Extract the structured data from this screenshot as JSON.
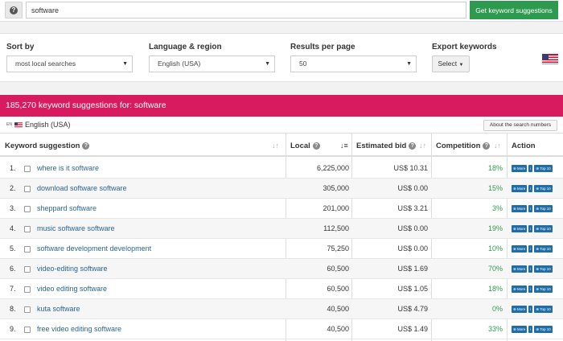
{
  "search": {
    "help_symbol": "?",
    "value": "software",
    "submit_label": "Get keyword suggestions"
  },
  "filters": {
    "sort_by": {
      "label": "Sort by",
      "selected": "most local searches"
    },
    "language": {
      "label": "Language & region",
      "selected": "English (USA)"
    },
    "results": {
      "label": "Results per page",
      "selected": "50"
    },
    "export": {
      "label": "Export keywords",
      "selected": "Select"
    }
  },
  "results": {
    "banner": "185,270 keyword suggestions for: software",
    "language_tag": "English (USA)",
    "language_code": "EN",
    "about_button": "About the search numbers"
  },
  "table": {
    "headers": {
      "keyword": "Keyword suggestion",
      "local": "Local",
      "bid": "Estimated bid",
      "competition": "Competition",
      "action": "Action"
    },
    "action_labels": {
      "more": "More",
      "info": "i",
      "top": "Top 10"
    },
    "rows": [
      {
        "num": "1.",
        "keyword": "where is it software",
        "local": "6,225,000",
        "bid": "US$ 10.31",
        "competition": "18%"
      },
      {
        "num": "2.",
        "keyword": "download software software",
        "local": "305,000",
        "bid": "US$ 0.00",
        "competition": "15%"
      },
      {
        "num": "3.",
        "keyword": "sheppard software",
        "local": "201,000",
        "bid": "US$ 3.21",
        "competition": "3%"
      },
      {
        "num": "4.",
        "keyword": "music software software",
        "local": "112,500",
        "bid": "US$ 0.00",
        "competition": "19%"
      },
      {
        "num": "5.",
        "keyword": "software development development",
        "local": "75,250",
        "bid": "US$ 0.00",
        "competition": "10%"
      },
      {
        "num": "6.",
        "keyword": "video-editing software",
        "local": "60,500",
        "bid": "US$ 1.69",
        "competition": "70%"
      },
      {
        "num": "7.",
        "keyword": "video editing software",
        "local": "60,500",
        "bid": "US$ 1.05",
        "competition": "18%"
      },
      {
        "num": "8.",
        "keyword": "kuta software",
        "local": "40,500",
        "bid": "US$ 4.79",
        "competition": "0%"
      },
      {
        "num": "9.",
        "keyword": "free video editing software",
        "local": "40,500",
        "bid": "US$ 1.49",
        "competition": "33%"
      }
    ]
  },
  "colors": {
    "banner": "#d81b5e",
    "submit": "#2d9a4f",
    "link": "#2a6496",
    "competition": "#2d9a4f",
    "action_button": "#1f6ea8"
  },
  "icons": {
    "help": "question-circle-icon",
    "sort": "sort-arrows-icon",
    "flag": "us-flag-icon",
    "caret": "caret-down-icon"
  }
}
